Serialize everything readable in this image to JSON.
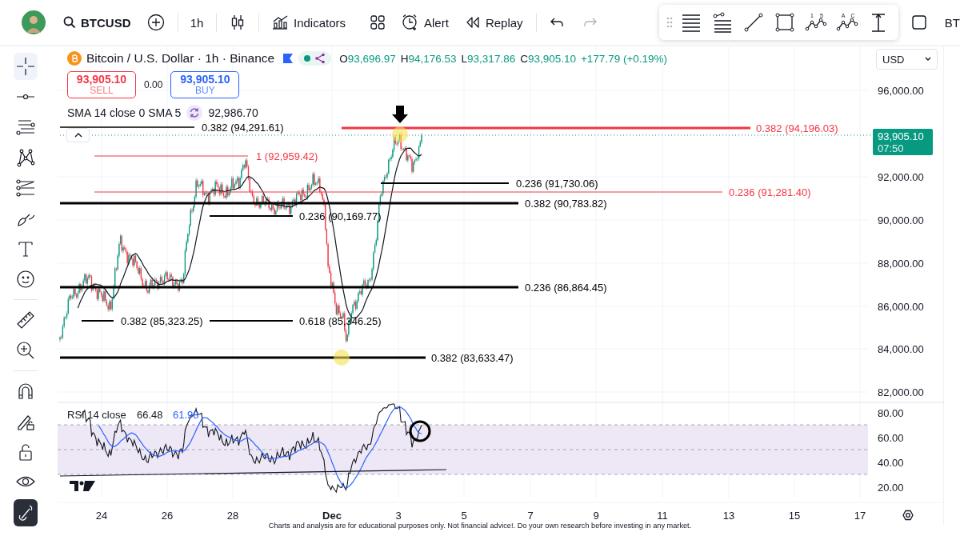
{
  "toolbar": {
    "symbol": "BTCUSD",
    "interval": "1h",
    "buttons": [
      {
        "kind": "indicators",
        "label": "Indicators"
      },
      {
        "kind": "layout"
      },
      {
        "kind": "alert",
        "label": "Alert"
      },
      {
        "kind": "replay",
        "label": "Replay"
      }
    ],
    "history": [
      {
        "kind": "undo",
        "disabled": false
      },
      {
        "kind": "redo",
        "disabled": true
      }
    ],
    "drawing_tools": [
      {
        "kind": "lines"
      },
      {
        "kind": "fib"
      },
      {
        "kind": "trend"
      },
      {
        "kind": "rect"
      },
      {
        "kind": "wave",
        "marks": [
          "1",
          "5"
        ]
      },
      {
        "kind": "wave",
        "marks": [
          "A",
          "C"
        ]
      },
      {
        "kind": "range"
      }
    ],
    "overflow_text": "BT"
  },
  "tool_groups": [
    {
      "tools": [
        {
          "kind": "crosshair",
          "selected": true
        },
        {
          "kind": "hline",
          "selected": false
        },
        {
          "kind": "fib",
          "selected": false
        },
        {
          "kind": "pattern",
          "selected": false
        },
        {
          "kind": "channel",
          "selected": false
        },
        {
          "kind": "brush",
          "selected": false
        },
        {
          "kind": "text",
          "selected": false
        },
        {
          "kind": "emoji",
          "selected": false
        }
      ]
    },
    {
      "tools": [
        {
          "kind": "ruler",
          "selected": false
        },
        {
          "kind": "zoom",
          "selected": false
        }
      ]
    },
    {
      "tools": [
        {
          "kind": "magnet",
          "selected": false
        },
        {
          "kind": "draw-lock",
          "selected": false
        },
        {
          "kind": "lock",
          "selected": false
        },
        {
          "kind": "eye",
          "selected": false
        },
        {
          "kind": "link",
          "selected": true
        }
      ]
    }
  ],
  "legend": {
    "title": "Bitcoin / U.S. Dollar · 1h · Binance",
    "ohlc": [
      {
        "label": "O",
        "value": "93,696.97"
      },
      {
        "label": "H",
        "value": "94,176.53"
      },
      {
        "label": "L",
        "value": "93,317.86"
      },
      {
        "label": "C",
        "value": "93,905.10"
      }
    ],
    "change": "+177.79 (+0.19%)",
    "sell": {
      "price": "93,905.10",
      "label": "SELL"
    },
    "spread": "0.00",
    "buy": {
      "price": "93,905.10",
      "label": "BUY"
    },
    "indicator": {
      "name": "SMA 14 close 0 SMA 5",
      "value": "92,986.70"
    }
  },
  "drawings": [
    {
      "label": "0.382 (94,291.61)",
      "color": "#000000"
    },
    {
      "label": "0.382 (94,196.03)",
      "color": "#f23645"
    },
    {
      "label": "1 (92,959.42)",
      "color": "#f23645"
    },
    {
      "label": "0.236 (91,730.06)",
      "color": "#000000"
    },
    {
      "label": "0.236 (91,281.40)",
      "color": "#f23645"
    },
    {
      "label": "0.382 (90,783.82)",
      "color": "#000000"
    },
    {
      "label": "0.236 (90,169.77)",
      "color": "#000000"
    },
    {
      "label": "0.236 (86,864.45)",
      "color": "#000000"
    },
    {
      "label": "0.382 (85,323.25)",
      "color": "#000000"
    },
    {
      "label": "0.618 (85,346.25)",
      "color": "#000000"
    },
    {
      "label": "0.382 (83,633.47)",
      "color": "#000000"
    }
  ],
  "price_axis": {
    "currency": "USD",
    "ticks": [
      "96,000.00",
      "92,000.00",
      "90,000.00",
      "88,000.00",
      "86,000.00",
      "84,000.00",
      "82,000.00"
    ],
    "last_price": "93,905.10",
    "countdown": "07:50"
  },
  "rsi": {
    "name": "RSI 14 close",
    "value": "66.48",
    "ma_value": "61.98",
    "ticks": [
      "80.00",
      "60.00",
      "40.00",
      "20.00"
    ]
  },
  "time_axis": {
    "ticks": [
      {
        "label": "24",
        "kind": "day"
      },
      {
        "label": "26",
        "kind": "day"
      },
      {
        "label": "28",
        "kind": "day"
      },
      {
        "label": "Dec",
        "kind": "month"
      },
      {
        "label": "3",
        "kind": "day"
      },
      {
        "label": "5",
        "kind": "day"
      },
      {
        "label": "7",
        "kind": "day"
      },
      {
        "label": "9",
        "kind": "day"
      },
      {
        "label": "11",
        "kind": "day"
      },
      {
        "label": "13",
        "kind": "day"
      },
      {
        "label": "15",
        "kind": "day"
      },
      {
        "label": "17",
        "kind": "day"
      }
    ]
  },
  "disclaimer": "Charts and analysis are for educational purposes only. Not financial advice!. Do your own research before investing in any market."
}
